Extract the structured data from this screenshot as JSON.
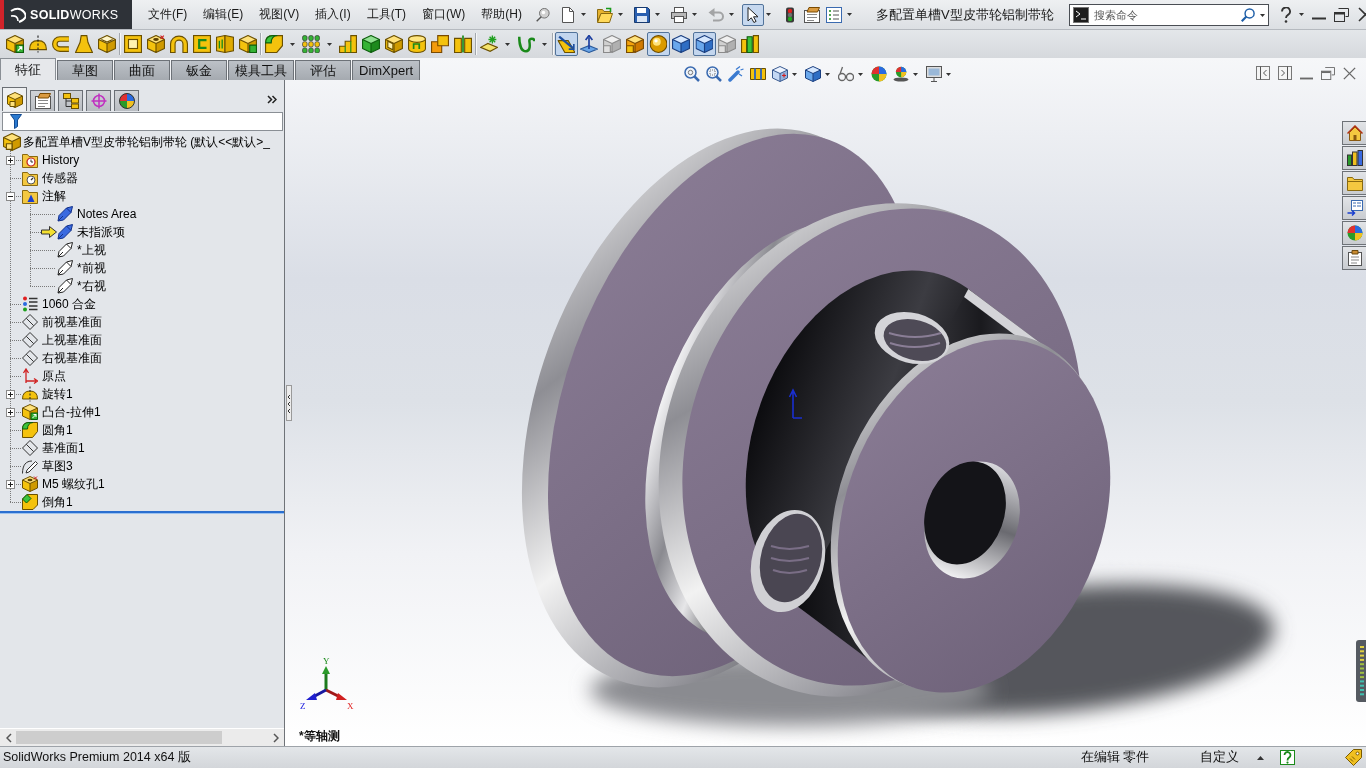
{
  "title_bar": {
    "logo": "**SOLID**WORKS",
    "menu": [
      "文件(F)",
      "编辑(E)",
      "视图(V)",
      "插入(I)",
      "工具(T)",
      "窗口(W)",
      "帮助(H)"
    ],
    "quick_access": [
      {
        "pressed": false,
        "disabled": false
      },
      {
        "pressed": false,
        "disabled": false
      },
      {
        "pressed": false,
        "disabled": false
      },
      {
        "pressed": false,
        "disabled": false
      },
      {
        "pressed": false,
        "disabled": true
      },
      {
        "pressed": true,
        "disabled": false
      },
      {
        "pressed": false,
        "disabled": false
      },
      {
        "pressed": false,
        "disabled": false
      },
      {
        "pressed": false,
        "disabled": false
      }
    ],
    "document_title": "多配置单槽V型皮带轮铝制带轮",
    "search": {
      "placeholder": "搜索命令"
    }
  },
  "command_toolbar": [
    {
      "pressed": false
    },
    {
      "pressed": false
    },
    {
      "pressed": false
    },
    {
      "pressed": false
    },
    {
      "pressed": false
    },
    {
      "pressed": false
    },
    {
      "pressed": false
    },
    {
      "pressed": false
    },
    {
      "pressed": false
    },
    {
      "pressed": false
    },
    {
      "pressed": false
    },
    {
      "pressed": false
    },
    {
      "pressed": false
    },
    {
      "pressed": false
    },
    {
      "pressed": false
    },
    {
      "pressed": false
    },
    {
      "pressed": false
    },
    {
      "pressed": false
    },
    {
      "pressed": false
    },
    {
      "pressed": false
    },
    {
      "pressed": false
    },
    {
      "pressed": true
    },
    {
      "pressed": false
    },
    {
      "pressed": false
    },
    {
      "pressed": false
    },
    {
      "pressed": true
    },
    {
      "pressed": false
    },
    {
      "pressed": true
    },
    {
      "pressed": false
    },
    {
      "pressed": false
    }
  ],
  "command_tabs": [
    {
      "label": "特征",
      "selected": true
    },
    {
      "label": "草图",
      "selected": false
    },
    {
      "label": "曲面",
      "selected": false
    },
    {
      "label": "钣金",
      "selected": false
    },
    {
      "label": "模具工具",
      "selected": false
    },
    {
      "label": "评估",
      "selected": false
    },
    {
      "label": "DimXpert",
      "selected": false
    }
  ],
  "feature_manager": {
    "panel_tabs": [
      {
        "selected": true
      },
      {
        "selected": false
      },
      {
        "selected": false
      },
      {
        "selected": false
      },
      {
        "selected": false
      }
    ],
    "tree": {
      "label": "多配置单槽V型皮带轮铝制带轮 (默认<<默认>_",
      "kind": "part",
      "children": [
        {
          "label": "History",
          "kind": "history",
          "expanded": false
        },
        {
          "label": "传感器",
          "kind": "sensors"
        },
        {
          "label": "注解",
          "kind": "annotations",
          "expanded": true,
          "children": [
            {
              "label": "Notes Area",
              "kind": "notes",
              "active": false
            },
            {
              "label": "未指派项",
              "kind": "notes",
              "active": true
            },
            {
              "label": "*上视",
              "kind": "view",
              "active": false
            },
            {
              "label": "*前视",
              "kind": "view",
              "active": false
            },
            {
              "label": "*右视",
              "kind": "view",
              "active": false
            }
          ]
        },
        {
          "label": "1060 合金",
          "kind": "material"
        },
        {
          "label": "前视基准面",
          "kind": "plane"
        },
        {
          "label": "上视基准面",
          "kind": "plane"
        },
        {
          "label": "右视基准面",
          "kind": "plane"
        },
        {
          "label": "原点",
          "kind": "origin"
        },
        {
          "label": "旋转1",
          "kind": "revolve",
          "expanded": false
        },
        {
          "label": "凸台-拉伸1",
          "kind": "extrude",
          "expanded": false
        },
        {
          "label": "圆角1",
          "kind": "fillet"
        },
        {
          "label": "基准面1",
          "kind": "plane"
        },
        {
          "label": "草图3",
          "kind": "sketch"
        },
        {
          "label": "M5 螺纹孔1",
          "kind": "hole",
          "expanded": false
        },
        {
          "label": "倒角1",
          "kind": "chamfer"
        }
      ]
    }
  },
  "viewport": {
    "triad": {
      "x": "X",
      "y": "Y",
      "z": "Z"
    },
    "view_label": "*等轴测"
  },
  "status_bar": {
    "product": "SolidWorks Premium 2014 x64 版",
    "mode": "在编辑 零件",
    "units": "自定义"
  }
}
